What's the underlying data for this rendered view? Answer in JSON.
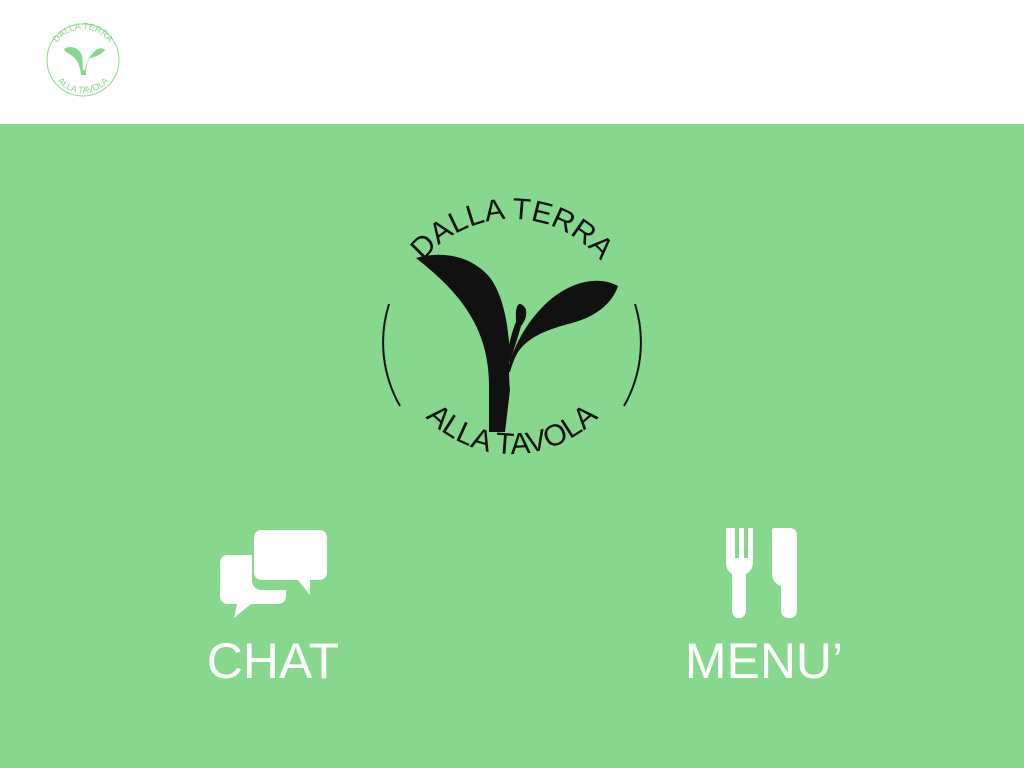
{
  "colors": {
    "background_main": "#88d78e",
    "header_background": "#ffffff",
    "logo_dark": "#111111",
    "accent_white": "#ffffff"
  },
  "brand": {
    "top_text": "DALLA TERRA",
    "bottom_text": "ALLA TAVOLA"
  },
  "actions": [
    {
      "label": "CHAT",
      "icon": "chat-bubbles-icon"
    },
    {
      "label": "MENU’",
      "icon": "fork-knife-icon"
    }
  ]
}
